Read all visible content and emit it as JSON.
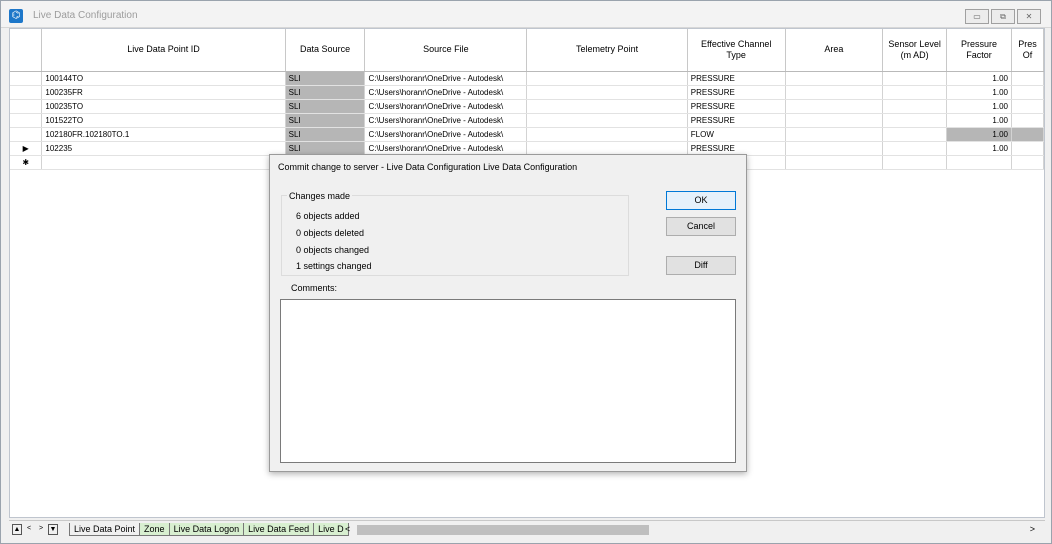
{
  "window": {
    "title": "Live Data Configuration",
    "controls": [
      "▭",
      "⧉",
      "✕"
    ]
  },
  "grid": {
    "columns": [
      "",
      "Live Data Point ID",
      "Data Source",
      "Source File",
      "Telemetry Point",
      "Effective Channel Type",
      "Area",
      "Sensor Level (m AD)",
      "Pressure Factor",
      "Pres Of"
    ],
    "rows": [
      {
        "marker": "",
        "id": "100144TO",
        "source": "SLI",
        "file": "C:\\Users\\horanr\\OneDrive - Autodesk\\",
        "telemetry": "",
        "type": "PRESSURE",
        "area": "",
        "sensor": "",
        "factor": "1.00",
        "grey_factor": false
      },
      {
        "marker": "",
        "id": "100235FR",
        "source": "SLI",
        "file": "C:\\Users\\horanr\\OneDrive - Autodesk\\",
        "telemetry": "",
        "type": "PRESSURE",
        "area": "",
        "sensor": "",
        "factor": "1.00",
        "grey_factor": false
      },
      {
        "marker": "",
        "id": "100235TO",
        "source": "SLI",
        "file": "C:\\Users\\horanr\\OneDrive - Autodesk\\",
        "telemetry": "",
        "type": "PRESSURE",
        "area": "",
        "sensor": "",
        "factor": "1.00",
        "grey_factor": false
      },
      {
        "marker": "",
        "id": "101522TO",
        "source": "SLI",
        "file": "C:\\Users\\horanr\\OneDrive - Autodesk\\",
        "telemetry": "",
        "type": "PRESSURE",
        "area": "",
        "sensor": "",
        "factor": "1.00",
        "grey_factor": false
      },
      {
        "marker": "",
        "id": "102180FR.102180TO.1",
        "source": "SLI",
        "file": "C:\\Users\\horanr\\OneDrive - Autodesk\\",
        "telemetry": "",
        "type": "FLOW",
        "area": "",
        "sensor": "",
        "factor": "1.00",
        "grey_factor": true
      },
      {
        "marker": "▶",
        "id": "102235",
        "source": "SLI",
        "file": "C:\\Users\\horanr\\OneDrive - Autodesk\\",
        "telemetry": "",
        "type": "PRESSURE",
        "area": "",
        "sensor": "",
        "factor": "1.00",
        "grey_factor": false
      },
      {
        "marker": "✱",
        "id": "",
        "source": "",
        "file": "",
        "telemetry": "",
        "type": "",
        "area": "",
        "sensor": "",
        "factor": "",
        "grey_factor": false
      }
    ]
  },
  "statusbar": {
    "tabs": [
      "Live Data Point",
      "Zone",
      "Live Data Logon",
      "Live Data Feed",
      "Live D"
    ],
    "active_tab": "Live Data Point",
    "nav": [
      "▲",
      "<",
      ">",
      "▼"
    ]
  },
  "dialog": {
    "title": "Commit change to server - Live Data Configuration Live Data Configuration",
    "group_label": "Changes made",
    "stats": [
      "6 objects added",
      "0 objects deleted",
      "0 objects changed",
      "1 settings changed"
    ],
    "ok_label": "OK",
    "cancel_label": "Cancel",
    "diff_label": "Diff",
    "comments_label": "Comments:",
    "comments_value": ""
  }
}
